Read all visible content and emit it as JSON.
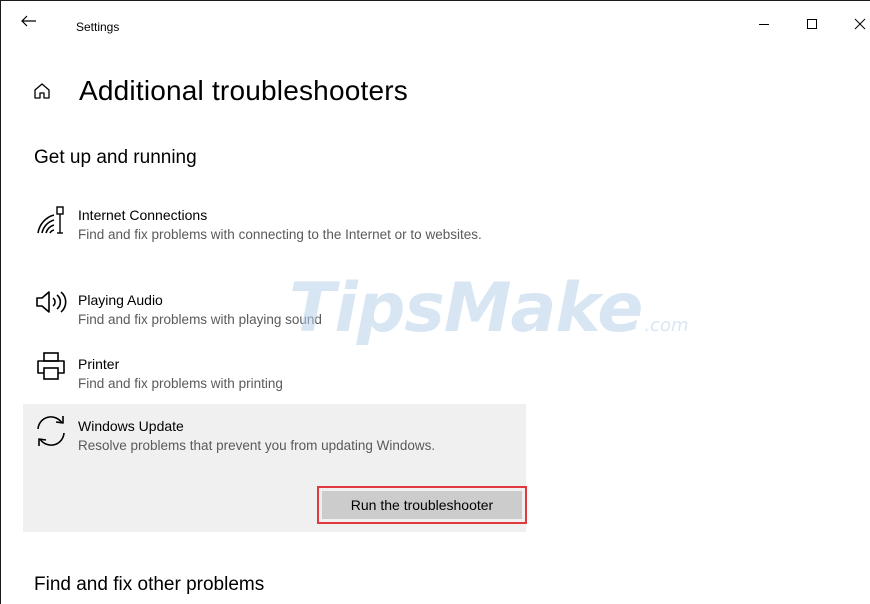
{
  "window": {
    "title": "Settings",
    "controls": {
      "minimize": "–",
      "maximize": "☐",
      "close": "✕"
    }
  },
  "page": {
    "title": "Additional troubleshooters"
  },
  "sections": {
    "get_up_running": "Get up and running",
    "find_fix_other": "Find and fix other problems"
  },
  "troubleshooters": [
    {
      "name": "Internet Connections",
      "description": "Find and fix problems with connecting to the Internet or to websites.",
      "icon": "wifi-network-icon"
    },
    {
      "name": "Playing Audio",
      "description": "Find and fix problems with playing sound",
      "icon": "speaker-icon"
    },
    {
      "name": "Printer",
      "description": "Find and fix problems with printing",
      "icon": "printer-icon"
    },
    {
      "name": "Windows Update",
      "description": "Resolve problems that prevent you from updating Windows.",
      "icon": "sync-icon",
      "selected": true,
      "action_label": "Run the troubleshooter"
    }
  ],
  "watermark": {
    "main": "TipsMake",
    "suffix": ".com"
  },
  "colors": {
    "highlight_border": "#e0393e",
    "selected_bg": "#f0f0f0",
    "button_bg": "#cccccc"
  }
}
